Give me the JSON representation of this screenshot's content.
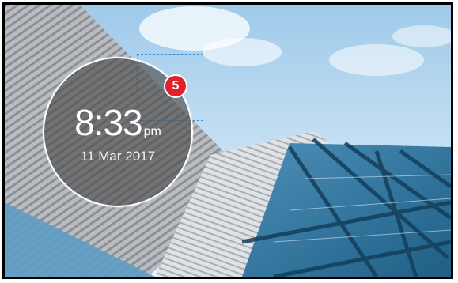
{
  "clock": {
    "time": "8:33",
    "ampm": "pm",
    "date": "11 Mar 2017"
  },
  "notifications": {
    "count": "5"
  },
  "colors": {
    "badge": "#e0202a",
    "callout": "#3a8ed8",
    "clock_bg": "rgba(70,70,70,0.62)"
  }
}
